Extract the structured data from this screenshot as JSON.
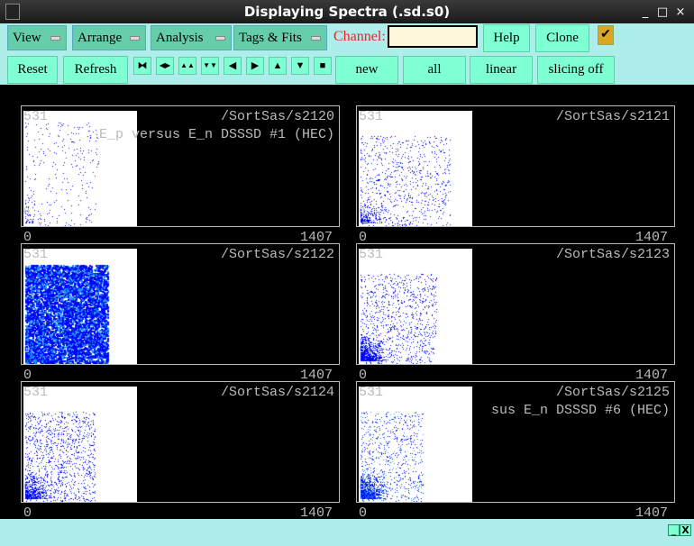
{
  "window": {
    "title": "Displaying Spectra (.sd.s0)",
    "minimize": "_",
    "maximize": "□",
    "close": "×"
  },
  "menus": [
    "View",
    "Arrange",
    "Analysis",
    "Tags & Fits"
  ],
  "channel": {
    "label": "Channel:",
    "value": ""
  },
  "buttons": {
    "help": "Help",
    "clone": "Clone",
    "check": "✔",
    "reset": "Reset",
    "refresh": "Refresh",
    "new": "new",
    "all": "all",
    "linear": "linear",
    "slicing": "slicing off"
  },
  "nav_icons": [
    "⧓",
    "◀▶",
    "▲▲",
    "▼▼",
    "◀",
    "▶",
    "▲",
    "▼",
    "■"
  ],
  "panels": [
    {
      "name": "/SortSas/s2120",
      "subtitle": "E_p versus E_n DSSSD #1 (HEC)",
      "ymax": "531",
      "xmin": "0",
      "xmax": "1407",
      "ymin": "0"
    },
    {
      "name": "/SortSas/s2121",
      "subtitle": "",
      "ymax": "531",
      "xmin": "0",
      "xmax": "1407",
      "ymin": "0"
    },
    {
      "name": "/SortSas/s2122",
      "subtitle": "",
      "ymax": "531",
      "xmin": "0",
      "xmax": "1407",
      "ymin": "0"
    },
    {
      "name": "/SortSas/s2123",
      "subtitle": "",
      "ymax": "531",
      "xmin": "0",
      "xmax": "1407",
      "ymin": "0"
    },
    {
      "name": "/SortSas/s2124",
      "subtitle": "",
      "ymax": "531",
      "xmin": "0",
      "xmax": "1407",
      "ymin": "0"
    },
    {
      "name": "/SortSas/s2125",
      "subtitle": "sus E_n DSSSD #6 (HEC)",
      "ymax": "531",
      "xmin": "0",
      "xmax": "1407",
      "ymin": "0"
    }
  ],
  "footer": {
    "minimize": "_",
    "close": "X"
  }
}
